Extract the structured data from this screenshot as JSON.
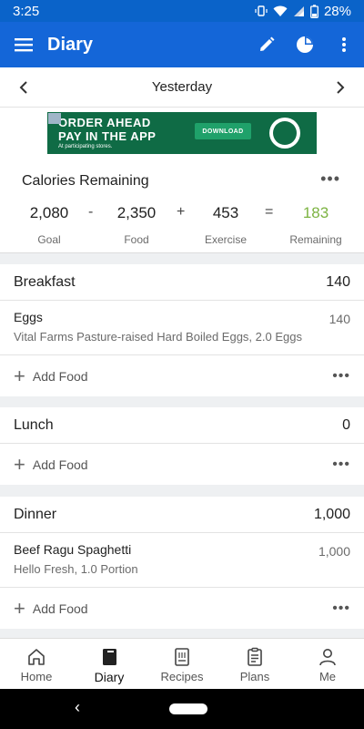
{
  "status": {
    "time": "3:25",
    "battery": "28%"
  },
  "app_bar": {
    "title": "Diary"
  },
  "date_nav": {
    "label": "Yesterday"
  },
  "ad": {
    "line1": "ORDER AHEAD",
    "line2": "PAY IN THE APP",
    "line3": "At participating stores.",
    "cta": "DOWNLOAD"
  },
  "calories": {
    "title": "Calories Remaining",
    "more": "•••",
    "goal": "2,080",
    "goal_label": "Goal",
    "minus": "-",
    "food": "2,350",
    "food_label": "Food",
    "plus": "+",
    "exercise": "453",
    "exercise_label": "Exercise",
    "equals": "=",
    "remaining": "183",
    "remaining_label": "Remaining",
    "remaining_color": "#7cb342"
  },
  "meals": {
    "breakfast": {
      "name": "Breakfast",
      "total": "140",
      "items": [
        {
          "name": "Eggs",
          "desc": "Vital Farms Pasture-raised Hard Boiled Eggs, 2.0 Eggs",
          "cal": "140"
        }
      ],
      "add_label": "Add Food",
      "more": "•••"
    },
    "lunch": {
      "name": "Lunch",
      "total": "0",
      "add_label": "Add Food",
      "more": "•••"
    },
    "dinner": {
      "name": "Dinner",
      "total": "1,000",
      "items": [
        {
          "name": "Beef Ragu Spaghetti",
          "desc": "Hello Fresh, 1.0 Portion",
          "cal": "1,000"
        }
      ],
      "add_label": "Add Food",
      "more": "•••"
    }
  },
  "bottom_nav": {
    "items": [
      {
        "label": "Home",
        "icon": "home-icon"
      },
      {
        "label": "Diary",
        "icon": "diary-icon"
      },
      {
        "label": "Recipes",
        "icon": "recipes-icon"
      },
      {
        "label": "Plans",
        "icon": "plans-icon"
      },
      {
        "label": "Me",
        "icon": "person-icon"
      }
    ],
    "active": "Diary"
  },
  "colors": {
    "primary": "#1466d8",
    "status_bar": "#0a63c9",
    "remaining_green": "#7cb342"
  }
}
